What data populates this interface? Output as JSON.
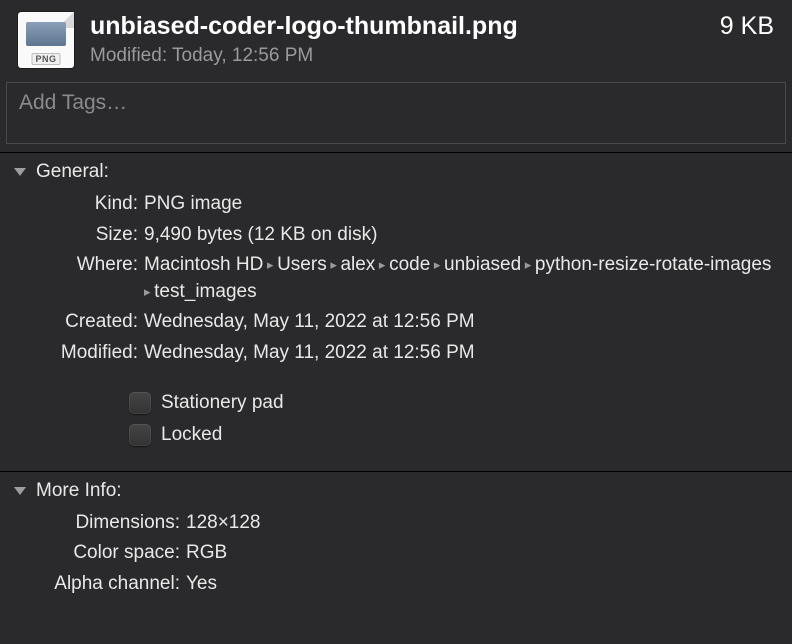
{
  "header": {
    "filename": "unbiased-coder-logo-thumbnail.png",
    "filesize": "9 KB",
    "thumb_badge": "PNG",
    "modified_label": "Modified:",
    "modified_value": "Today, 12:56 PM"
  },
  "tags": {
    "placeholder": "Add Tags…"
  },
  "general": {
    "title": "General:",
    "kind_label": "Kind:",
    "kind_value": "PNG image",
    "size_label": "Size:",
    "size_value": "9,490 bytes (12 KB on disk)",
    "where_label": "Where:",
    "where_path": [
      "Macintosh HD",
      "Users",
      "alex",
      "code",
      "unbiased",
      "python-resize-rotate-images",
      "test_images"
    ],
    "created_label": "Created:",
    "created_value": "Wednesday, May 11, 2022 at 12:56 PM",
    "modified_label": "Modified:",
    "modified_value": "Wednesday, May 11, 2022 at 12:56 PM",
    "stationery_label": "Stationery pad",
    "locked_label": "Locked"
  },
  "more": {
    "title": "More Info:",
    "dimensions_label": "Dimensions:",
    "dimensions_value": "128×128",
    "colorspace_label": "Color space:",
    "colorspace_value": "RGB",
    "alpha_label": "Alpha channel:",
    "alpha_value": "Yes"
  }
}
